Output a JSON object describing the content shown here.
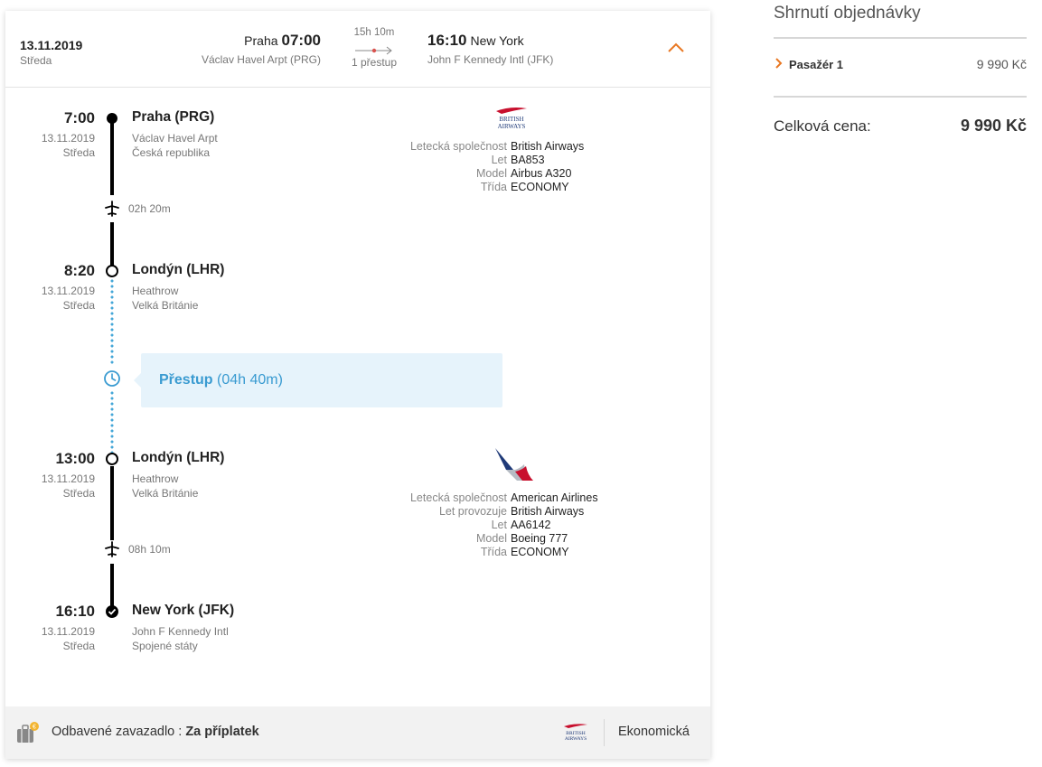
{
  "header": {
    "date": "13.11.2019",
    "day": "Středa",
    "departure": {
      "city": "Praha",
      "time": "07:00",
      "airport": "Václav Havel Arpt (PRG)"
    },
    "duration": "15h 10m",
    "stops": "1 přestup",
    "arrival": {
      "time": "16:10",
      "city": "New York",
      "airport": "John F Kennedy Intl (JFK)"
    }
  },
  "timeline": {
    "stop1": {
      "time": "7:00",
      "date": "13.11.2019",
      "day": "Středa",
      "name": "Praha (PRG)",
      "line1": "Václav Havel Arpt",
      "line2": "Česká republika"
    },
    "leg1_duration": "02h 20m",
    "stop2": {
      "time": "8:20",
      "date": "13.11.2019",
      "day": "Středa",
      "name": "Londýn (LHR)",
      "line1": "Heathrow",
      "line2": "Velká Británie"
    },
    "transfer": {
      "label": "Přestup",
      "duration": "(04h 40m)"
    },
    "stop3": {
      "time": "13:00",
      "date": "13.11.2019",
      "day": "Středa",
      "name": "Londýn (LHR)",
      "line1": "Heathrow",
      "line2": "Velká Británie"
    },
    "leg2_duration": "08h 10m",
    "stop4": {
      "time": "16:10",
      "date": "13.11.2019",
      "day": "Středa",
      "name": "New York (JFK)",
      "line1": "John F Kennedy Intl",
      "line2": "Spojené státy"
    }
  },
  "flight1": {
    "logo_text_1": "BRITISH",
    "logo_text_2": "AIRWAYS",
    "rows": [
      {
        "k": "Letecká společnost",
        "v": "British Airways"
      },
      {
        "k": "Let",
        "v": "BA853"
      },
      {
        "k": "Model",
        "v": "Airbus A320"
      },
      {
        "k": "Třída",
        "v": "ECONOMY"
      }
    ]
  },
  "flight2": {
    "rows": [
      {
        "k": "Letecká společnost",
        "v": "American Airlines"
      },
      {
        "k": "Let provozuje",
        "v": "British Airways"
      },
      {
        "k": "Let",
        "v": "AA6142"
      },
      {
        "k": "Model",
        "v": "Boeing 777"
      },
      {
        "k": "Třída",
        "v": "ECONOMY"
      }
    ]
  },
  "footer": {
    "baggage_label": "Odbavené zavazadlo :",
    "baggage_value": "Za příplatek",
    "logo_text_1": "BRITISH",
    "logo_text_2": "AIRWAYS",
    "cabin_class": "Ekonomická"
  },
  "summary": {
    "title": "Shrnutí objednávky",
    "passenger_label": "Pasažér 1",
    "passenger_price": "9 990 Kč",
    "total_label": "Celková cena:",
    "total_price": "9 990 Kč"
  },
  "colors": {
    "accent_orange": "#e87722",
    "transfer_blue": "#3a9bd1",
    "transfer_bg": "#e6f3fb",
    "ba_red": "#c8102e",
    "ba_blue": "#1f3a78"
  },
  "icons": [
    "chevron-up-icon",
    "plane-icon",
    "clock-icon",
    "checkmark-icon",
    "baggage-icon",
    "chevron-right-icon",
    "arrow-right-icon"
  ]
}
